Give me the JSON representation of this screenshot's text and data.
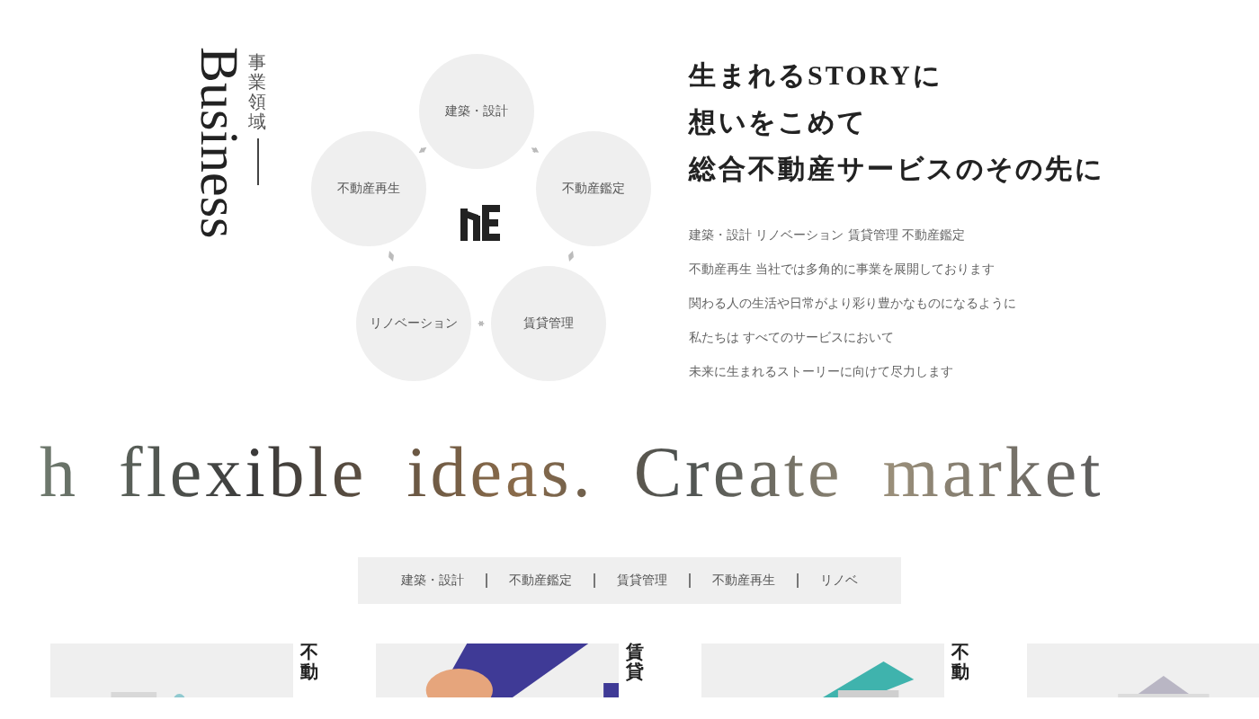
{
  "heading": {
    "label": "事業領域",
    "title": "Business"
  },
  "cycle": {
    "nodes": [
      {
        "label": "建築・設計"
      },
      {
        "label": "不動産鑑定"
      },
      {
        "label": "賃貸管理"
      },
      {
        "label": "リノベーション"
      },
      {
        "label": "不動産再生"
      }
    ]
  },
  "intro": {
    "headlines": [
      "生まれるSTORYに",
      "想いをこめて",
      "総合不動産サービスのその先に"
    ],
    "lines": [
      "建築・設計 リノベーション 賃貸管理 不動産鑑定",
      "不動産再生 当社では多角的に事業を展開しております",
      "関わる人の生活や日常がより彩り豊かなものになるように",
      "私たちは すべてのサービスにおいて",
      "未来に生まれるストーリーに向けて尽力します"
    ]
  },
  "marquee": "h flexible ideas. Create market",
  "tabs": [
    {
      "label": "建築・設計"
    },
    {
      "label": "不動産鑑定"
    },
    {
      "label": "賃貸管理"
    },
    {
      "label": "不動産再生"
    },
    {
      "label": "リノベ"
    }
  ],
  "cards": [
    {
      "label": "不動",
      "kind": "picture"
    },
    {
      "label": "賃貸",
      "kind": "picture"
    },
    {
      "label": "不動",
      "kind": "picture"
    },
    {
      "kind": "picture"
    }
  ]
}
